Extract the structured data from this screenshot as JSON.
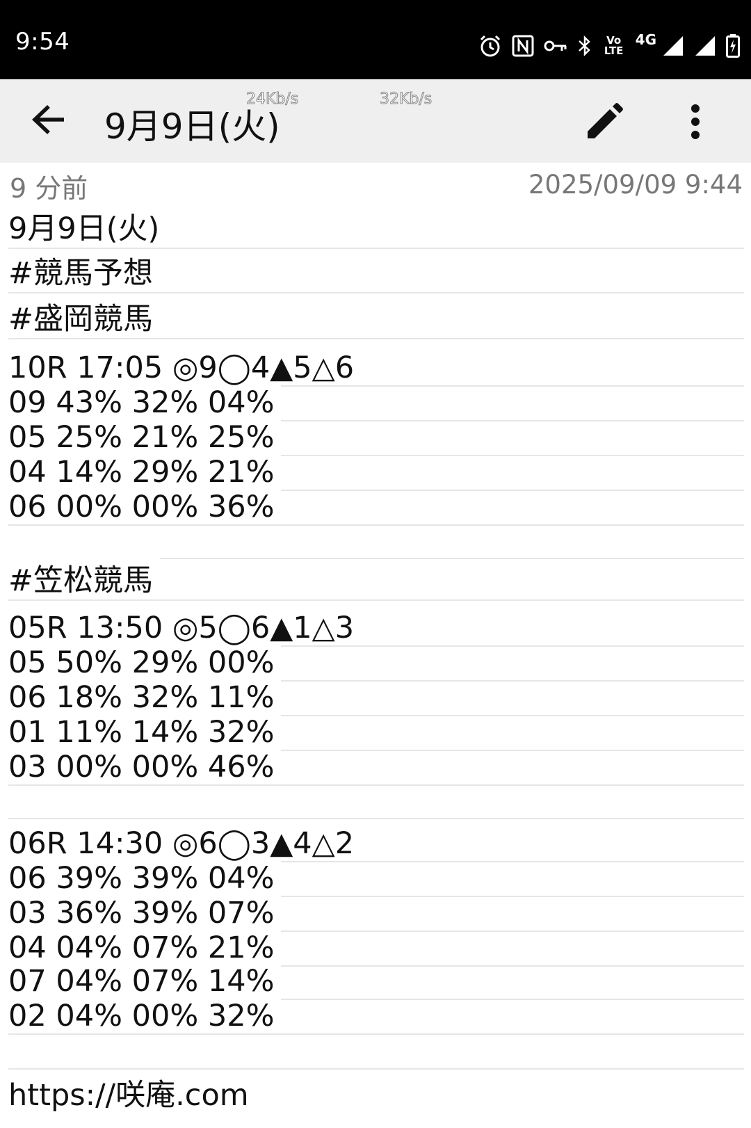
{
  "status_bar": {
    "time": "9:54",
    "network": "4G",
    "volte": "Vo LTE",
    "icons": [
      "alarm-icon",
      "nfc-icon",
      "vpn-key-icon",
      "bluetooth-icon",
      "volte-icon",
      "signal-icon",
      "signal-icon",
      "battery-charging-icon"
    ]
  },
  "toolbar": {
    "title": "9月9日(火)",
    "speed_a": "24Kb/s",
    "speed_b": "32Kb/s",
    "icons": [
      "back-arrow-icon",
      "edit-pencil-icon",
      "more-vert-icon"
    ]
  },
  "meta": {
    "relative_time": "9 分前",
    "timestamp": "2025/09/09 9:44"
  },
  "note": {
    "lines": [
      "9月9日(火)",
      "#競馬予想",
      "#盛岡競馬",
      "10R 17:05 ◎9◯4▲5△6",
      "09 43% 32% 04%",
      "05 25% 21% 25%",
      "04 14% 29% 21%",
      "06 00% 00% 36%",
      "",
      "#笠松競馬",
      "05R 13:50 ◎5◯6▲1△3",
      "05 50% 29% 00%",
      "06 18% 32% 11%",
      "01 11% 14% 32%",
      "03 00% 00% 46%",
      "",
      "06R 14:30 ◎6◯3▲4△2",
      "06 39% 39% 04%",
      "03 36% 39% 07%",
      "04 04% 07% 21%",
      "07 04% 07% 14%",
      "02 04% 00% 32%",
      "",
      "https://咲庵.com"
    ]
  }
}
